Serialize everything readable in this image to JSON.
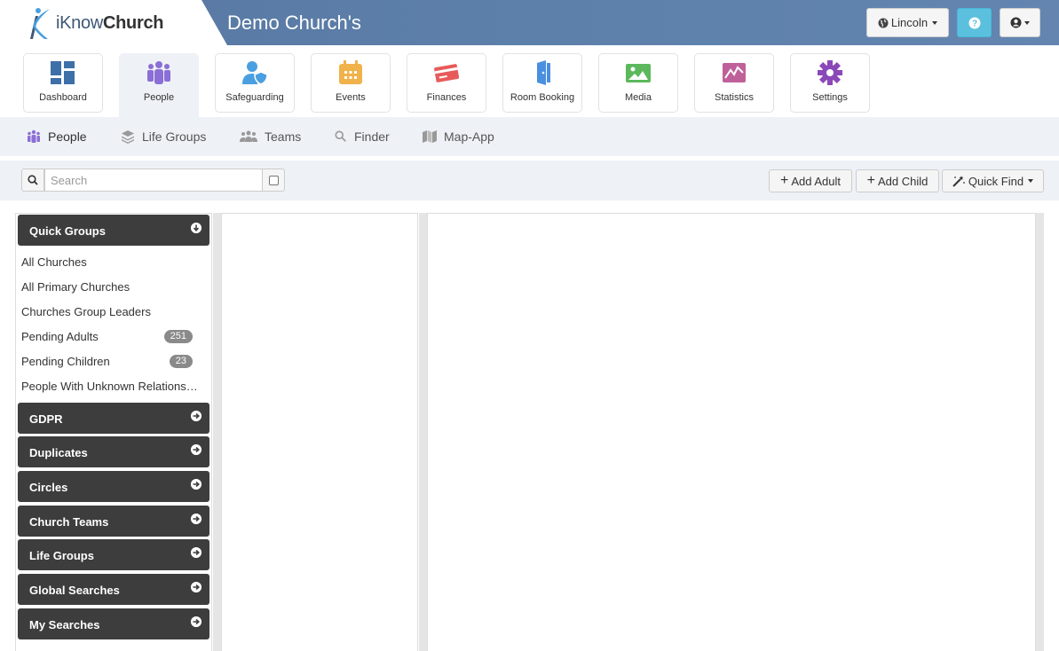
{
  "header": {
    "logo_prefix": "iKnow",
    "logo_suffix": "Church",
    "church_title": "Demo Church's",
    "location_button": "Lincoln",
    "help_icon": "question-circle-icon",
    "user_icon": "user-circle-icon"
  },
  "modules": [
    {
      "label": "Dashboard",
      "icon": "dashboard-icon",
      "color": "#3d6fa8"
    },
    {
      "label": "People",
      "icon": "people-icon",
      "color": "#8b6fd6",
      "active": true
    },
    {
      "label": "Safeguarding",
      "icon": "user-shield-icon",
      "color": "#4a9fe0"
    },
    {
      "label": "Events",
      "icon": "calendar-icon",
      "color": "#f0b24b"
    },
    {
      "label": "Finances",
      "icon": "credit-card-icon",
      "color": "#e85a5a"
    },
    {
      "label": "Room Booking",
      "icon": "door-icon",
      "color": "#4a8fe0"
    },
    {
      "label": "Media",
      "icon": "image-icon",
      "color": "#5cb85c"
    },
    {
      "label": "Statistics",
      "icon": "chart-icon",
      "color": "#c0609a"
    },
    {
      "label": "Settings",
      "icon": "gear-icon",
      "color": "#8b48b8"
    }
  ],
  "subnav": [
    {
      "label": "People",
      "icon": "people-icon",
      "active": true
    },
    {
      "label": "Life Groups",
      "icon": "layers-icon"
    },
    {
      "label": "Teams",
      "icon": "users-icon"
    },
    {
      "label": "Finder",
      "icon": "search-icon"
    },
    {
      "label": "Map-App",
      "icon": "map-icon"
    }
  ],
  "toolbar": {
    "search_placeholder": "Search",
    "search_value": "",
    "add_adult": "Add Adult",
    "add_child": "Add Child",
    "quick_find": "Quick Find"
  },
  "quick_groups": {
    "title": "Quick Groups",
    "items": [
      {
        "label": "All Churches"
      },
      {
        "label": "All Primary Churches"
      },
      {
        "label": "Churches Group Leaders"
      },
      {
        "label": "Pending Adults",
        "badge": "251"
      },
      {
        "label": "Pending Children",
        "badge": "23"
      },
      {
        "label": "People With Unknown Relationships"
      }
    ]
  },
  "groups": [
    {
      "label": "GDPR"
    },
    {
      "label": "Duplicates"
    },
    {
      "label": "Circles"
    },
    {
      "label": "Church Teams"
    },
    {
      "label": "Life Groups"
    },
    {
      "label": "Global Searches"
    },
    {
      "label": "My Searches"
    }
  ]
}
